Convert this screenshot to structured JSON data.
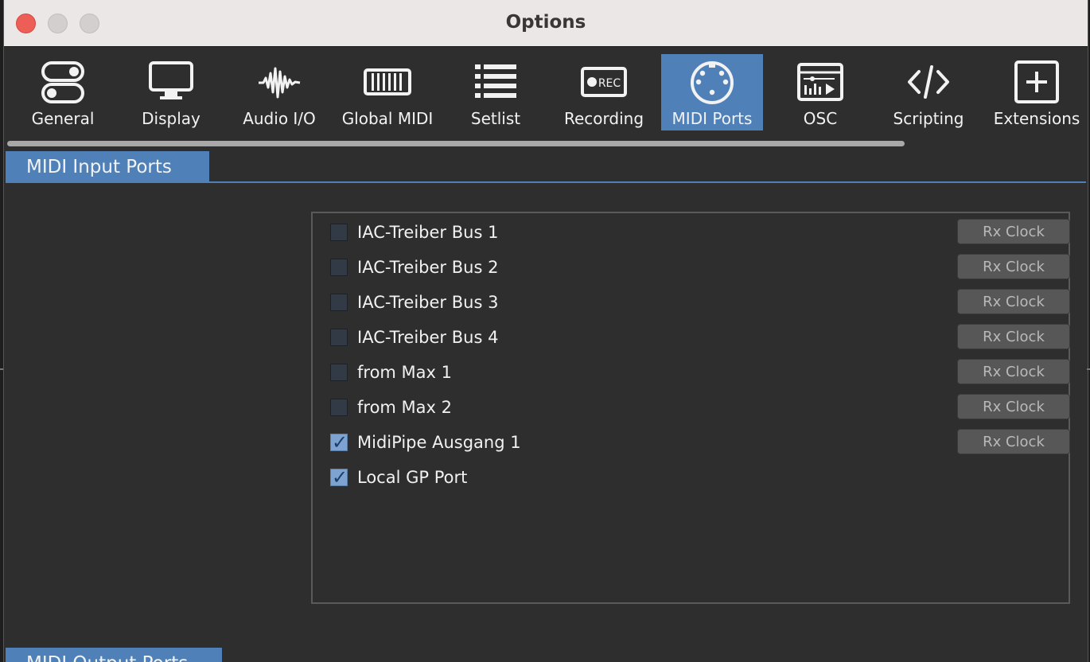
{
  "window": {
    "title": "Options"
  },
  "toolbar": {
    "items": [
      {
        "label": "General",
        "icon": "toggles-icon"
      },
      {
        "label": "Display",
        "icon": "monitor-icon"
      },
      {
        "label": "Audio I/O",
        "icon": "waveform-icon"
      },
      {
        "label": "Global MIDI",
        "icon": "keyboard-icon"
      },
      {
        "label": "Setlist",
        "icon": "list-icon"
      },
      {
        "label": "Recording",
        "icon": "rec-icon",
        "icon_text": "REC"
      },
      {
        "label": "MIDI Ports",
        "icon": "midi-din-icon",
        "active": true
      },
      {
        "label": "OSC",
        "icon": "osc-icon"
      },
      {
        "label": "Scripting",
        "icon": "code-icon"
      },
      {
        "label": "Extensions",
        "icon": "plus-box-icon"
      }
    ],
    "active_color": "#4f80b8"
  },
  "input_section": {
    "title": "MIDI Input Ports",
    "ports": [
      {
        "name": "IAC-Treiber Bus 1",
        "checked": false,
        "rx_label": "Rx Clock"
      },
      {
        "name": "IAC-Treiber Bus 2",
        "checked": false,
        "rx_label": "Rx Clock"
      },
      {
        "name": "IAC-Treiber Bus 3",
        "checked": false,
        "rx_label": "Rx Clock"
      },
      {
        "name": "IAC-Treiber Bus 4",
        "checked": false,
        "rx_label": "Rx Clock"
      },
      {
        "name": "from Max 1",
        "checked": false,
        "rx_label": "Rx Clock"
      },
      {
        "name": "from Max 2",
        "checked": false,
        "rx_label": "Rx Clock"
      },
      {
        "name": "MidiPipe Ausgang 1",
        "checked": true,
        "rx_label": "Rx Clock"
      },
      {
        "name": "Local GP Port",
        "checked": true,
        "rx_label": null
      }
    ]
  },
  "output_section": {
    "title": "MIDI Output Ports"
  }
}
